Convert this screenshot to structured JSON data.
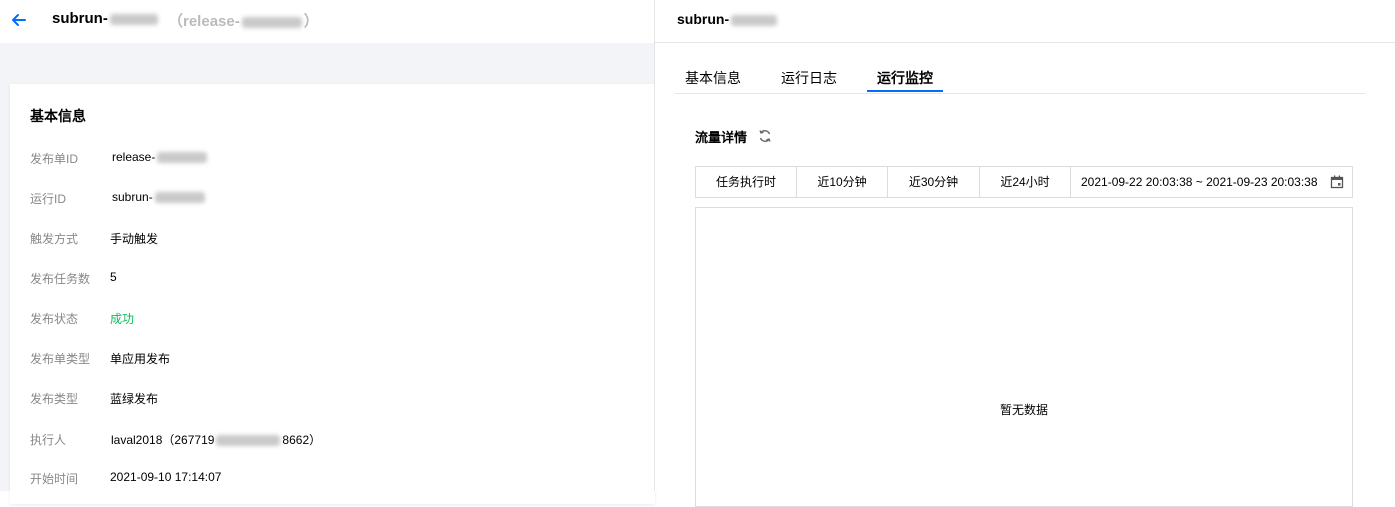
{
  "left": {
    "title_prefix": "subrun-",
    "subtitle_prefix": "（release-",
    "subtitle_suffix": "）",
    "card_title": "基本信息",
    "fields": [
      {
        "label": "发布单ID",
        "value": "release-",
        "redacted": true
      },
      {
        "label": "运行ID",
        "value": "subrun-",
        "redacted": true
      },
      {
        "label": "触发方式",
        "value": "手动触发"
      },
      {
        "label": "发布任务数",
        "value": "5"
      },
      {
        "label": "发布状态",
        "value": "成功",
        "status": "success"
      },
      {
        "label": "发布单类型",
        "value": "单应用发布"
      },
      {
        "label": "发布类型",
        "value": "蓝绿发布"
      },
      {
        "label": "执行人",
        "value": "laval2018（267719",
        "value_suffix": "8662）",
        "redacted": true
      },
      {
        "label": "开始时间",
        "value": "2021-09-10 17:14:07"
      }
    ]
  },
  "right": {
    "title_prefix": "subrun-",
    "tabs": [
      {
        "label": "基本信息",
        "active": false
      },
      {
        "label": "运行日志",
        "active": false
      },
      {
        "label": "运行监控",
        "active": true
      }
    ],
    "section_title": "流量详情",
    "filters": [
      "任务执行时",
      "近10分钟",
      "近30分钟",
      "近24小时"
    ],
    "date_range": "2021-09-22 20:03:38 ~ 2021-09-23 20:03:38",
    "empty_text": "暂无数据"
  },
  "colors": {
    "accent": "#006eff",
    "success": "#0abf5b",
    "label": "#888888",
    "border": "#dcdcdc"
  },
  "icons": [
    "arrow-left-icon",
    "refresh-icon",
    "calendar-icon"
  ]
}
